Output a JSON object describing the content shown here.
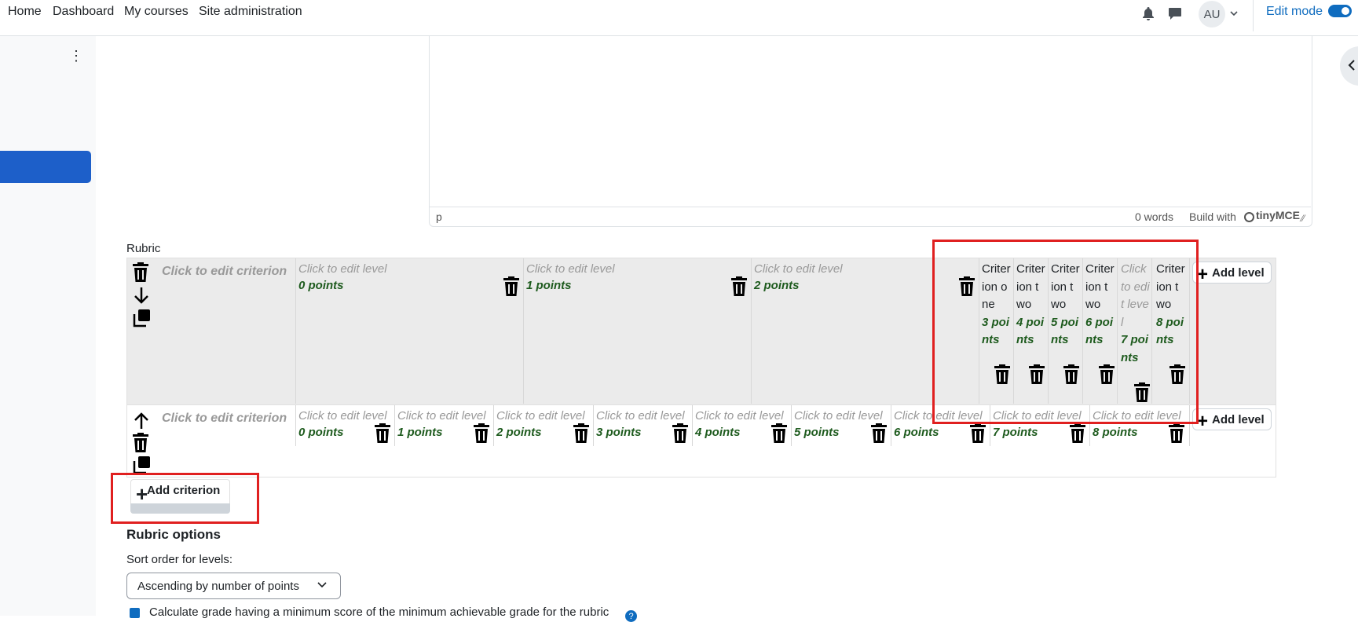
{
  "nav": {
    "home": "Home",
    "dashboard": "Dashboard",
    "my_courses": "My courses",
    "site_admin": "Site administration",
    "avatar_initials": "AU",
    "edit_mode": "Edit mode"
  },
  "editor": {
    "status_element": "p",
    "word_count": "0 words",
    "build_with": "Build with",
    "brand": "tinyMCE"
  },
  "rubric": {
    "label": "Rubric",
    "criterion_placeholder": "Click to edit criterion",
    "level_placeholder": "Click to edit level",
    "add_level": "Add level",
    "add_criterion": "Add criterion",
    "criterion1": {
      "wide_levels": [
        {
          "definition": "Click to edit level",
          "points": "0 points"
        },
        {
          "definition": "Click to edit level",
          "points": "1 points"
        },
        {
          "definition": "Click to edit level",
          "points": "2 points"
        }
      ],
      "narrow_levels": [
        {
          "definition": "Criterion one",
          "points": "3 points"
        },
        {
          "definition": "Criterion two",
          "points": "4 points"
        },
        {
          "definition": "Criterion two",
          "points": "5 points"
        },
        {
          "definition": "Criterion two",
          "points": "6 points"
        },
        {
          "definition": "Click to edit level",
          "points": "7 points",
          "placeholder": true
        },
        {
          "definition": "Criterion two",
          "points": "8 points"
        }
      ]
    },
    "criterion2": {
      "levels": [
        {
          "definition": "Click to edit level",
          "points": "0 points"
        },
        {
          "definition": "Click to edit level",
          "points": "1 points"
        },
        {
          "definition": "Click to edit level",
          "points": "2 points"
        },
        {
          "definition": "Click to edit level",
          "points": "3 points"
        },
        {
          "definition": "Click to edit level",
          "points": "4 points"
        },
        {
          "definition": "Click to edit level",
          "points": "5 points"
        },
        {
          "definition": "Click to edit level",
          "points": "6 points"
        },
        {
          "definition": "Click to edit level",
          "points": "7 points"
        },
        {
          "definition": "Click to edit level",
          "points": "8 points"
        }
      ]
    }
  },
  "options": {
    "title": "Rubric options",
    "sort_label": "Sort order for levels:",
    "sort_value": "Ascending by number of points",
    "calc_label": "Calculate grade having a minimum score of the minimum achievable grade for the rubric"
  },
  "colors": {
    "accent": "#0f6cbf",
    "points": "#1e5b1e",
    "highlight": "#e02020"
  }
}
